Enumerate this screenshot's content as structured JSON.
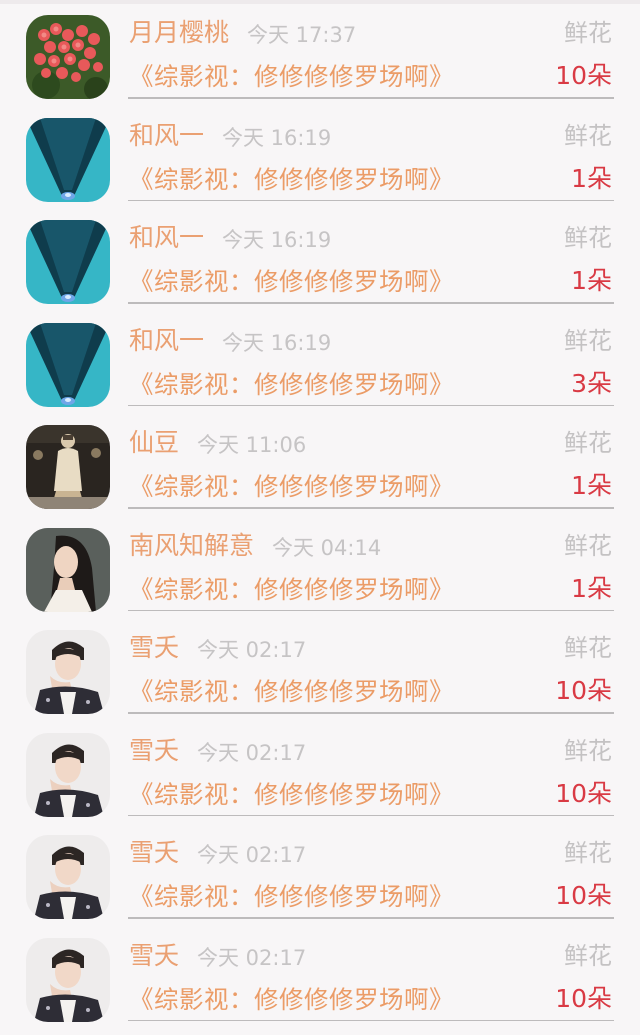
{
  "items": [
    {
      "avatar": "flower",
      "name": "月月樱桃",
      "time": "今天 17:37",
      "gift": "鲜花",
      "title": "《综影视：修修修修罗场啊》",
      "count": "10朵"
    },
    {
      "avatar": "water",
      "name": "和风一",
      "time": "今天 16:19",
      "gift": "鲜花",
      "title": "《综影视：修修修修罗场啊》",
      "count": "1朵"
    },
    {
      "avatar": "water",
      "name": "和风一",
      "time": "今天 16:19",
      "gift": "鲜花",
      "title": "《综影视：修修修修罗场啊》",
      "count": "1朵"
    },
    {
      "avatar": "water",
      "name": "和风一",
      "time": "今天 16:19",
      "gift": "鲜花",
      "title": "《综影视：修修修修罗场啊》",
      "count": "3朵"
    },
    {
      "avatar": "figurine",
      "name": "仙豆",
      "time": "今天 11:06",
      "gift": "鲜花",
      "title": "《综影视：修修修修罗场啊》",
      "count": "1朵"
    },
    {
      "avatar": "woman",
      "name": "南风知解意",
      "time": "今天 04:14",
      "gift": "鲜花",
      "title": "《综影视：修修修修罗场啊》",
      "count": "1朵"
    },
    {
      "avatar": "man",
      "name": "雪夭",
      "time": "今天 02:17",
      "gift": "鲜花",
      "title": "《综影视：修修修修罗场啊》",
      "count": "10朵"
    },
    {
      "avatar": "man",
      "name": "雪夭",
      "time": "今天 02:17",
      "gift": "鲜花",
      "title": "《综影视：修修修修罗场啊》",
      "count": "10朵"
    },
    {
      "avatar": "man",
      "name": "雪夭",
      "time": "今天 02:17",
      "gift": "鲜花",
      "title": "《综影视：修修修修罗场啊》",
      "count": "10朵"
    },
    {
      "avatar": "man",
      "name": "雪夭",
      "time": "今天 02:17",
      "gift": "鲜花",
      "title": "《综影视：修修修修罗场啊》",
      "count": "10朵"
    }
  ]
}
